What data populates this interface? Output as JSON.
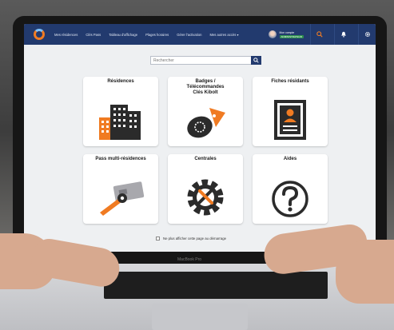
{
  "nav": {
    "items": [
      "Mes résidences",
      "Clés Pass",
      "Tableau d'affichage",
      "Plages horaires",
      "Gérer l'activation",
      "Mes autres accès ▾"
    ],
    "user_name": "Mon compte",
    "user_role": "ADMINISTRATEUR"
  },
  "search": {
    "placeholder": "Rechercher"
  },
  "cards": [
    {
      "title": "Résidences"
    },
    {
      "title": "Badges /\nTélécommandes\nClés Kibolt"
    },
    {
      "title": "Fiches résidants"
    },
    {
      "title": "Pass multi-résidences"
    },
    {
      "title": "Centrales"
    },
    {
      "title": "Aides"
    }
  ],
  "footer": {
    "checkbox_label": "Ne plus afficher cette page au démarrage"
  },
  "device": {
    "brand": "MacBook Pro"
  },
  "colors": {
    "navbar": "#223a6e",
    "accent": "#f07b22",
    "icon_dark": "#2b2b2b"
  }
}
